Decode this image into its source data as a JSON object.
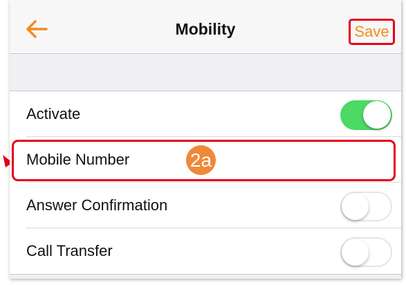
{
  "navbar": {
    "back_icon": "arrow-left-icon",
    "title": "Mobility",
    "save_label": "Save",
    "accent_color": "#f28c22"
  },
  "settings": {
    "rows": [
      {
        "label": "Activate",
        "toggle": true
      },
      {
        "label": "Mobile Number"
      },
      {
        "label": "Answer Confirmation",
        "toggle": false
      },
      {
        "label": "Call Transfer",
        "toggle": false
      }
    ]
  },
  "annotation": {
    "step_label": "2a",
    "highlight_color": "#e3001b",
    "badge_color": "#f0883a"
  },
  "colors": {
    "toggle_on": "#4cd964",
    "background": "#efeff4"
  }
}
